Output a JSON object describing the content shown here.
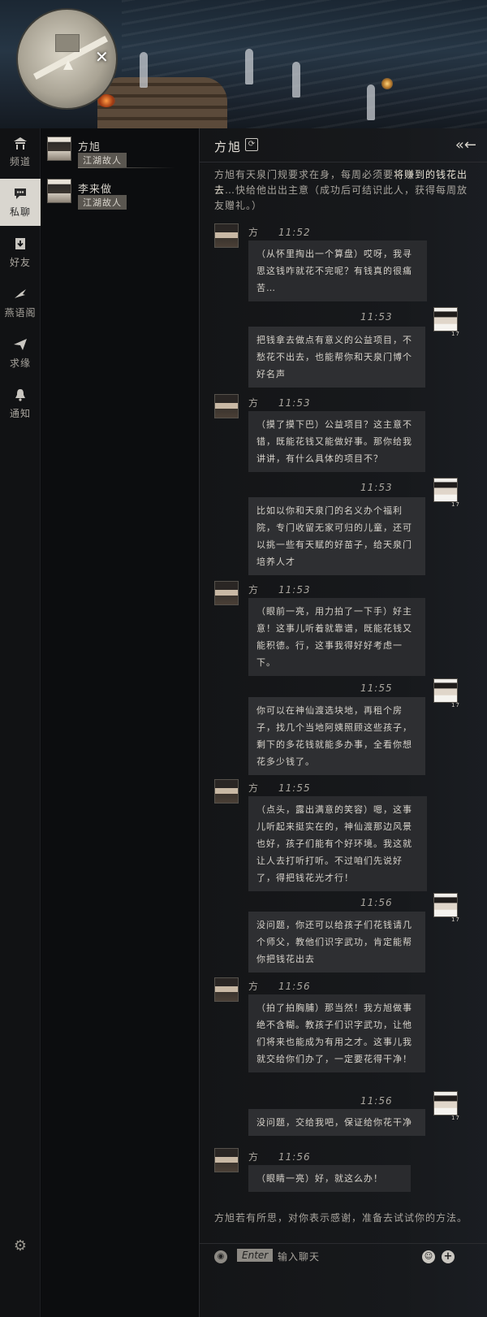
{
  "nav": [
    {
      "id": "channel",
      "label": "频道",
      "icon": "house-icon"
    },
    {
      "id": "private-chat",
      "label": "私聊",
      "icon": "chat-bubble-icon",
      "active": true
    },
    {
      "id": "friends",
      "label": "好友",
      "icon": "friend-download-icon"
    },
    {
      "id": "yanyu",
      "label": "燕语阁",
      "icon": "swallow-icon"
    },
    {
      "id": "qiuyuan",
      "label": "求缘",
      "icon": "paper-plane-icon"
    },
    {
      "id": "notice",
      "label": "通知",
      "icon": "bell-icon"
    }
  ],
  "contacts": [
    {
      "name": "方旭",
      "tag": "江湖故人",
      "selected": true
    },
    {
      "name": "李来做",
      "tag": "江湖故人",
      "selected": false
    }
  ],
  "chat": {
    "title": "方旭",
    "intro_pre": "方旭有天泉门规要求在身，每周必须要",
    "intro_highlight": "将赚到的钱花出去",
    "intro_post": "…快给他出出主意（成功后可结识此人，获得每周放友赠礼。）",
    "messages": [
      {
        "from": "other",
        "name": "方旭",
        "time": "11:52",
        "text": "（从怀里掏出一个算盘）哎呀，我寻思这钱咋就花不完呢？有钱真的很痛苦…"
      },
      {
        "from": "me",
        "time": "11:53",
        "text": "把钱拿去做点有意义的公益项目，不愁花不出去，也能帮你和天泉门博个好名声",
        "level": "17"
      },
      {
        "from": "other",
        "name": "方旭",
        "time": "11:53",
        "text": "（摸了摸下巴）公益项目？这主意不错，既能花钱又能做好事。那你给我讲讲，有什么具体的项目不？"
      },
      {
        "from": "me",
        "time": "11:53",
        "text": "比如以你和天泉门的名义办个福利院，专门收留无家可归的儿童，还可以挑一些有天赋的好苗子，给天泉门培养人才",
        "level": "17"
      },
      {
        "from": "other",
        "name": "方旭",
        "time": "11:53",
        "text": "（眼前一亮，用力拍了一下手）好主意！这事儿听着就靠谱，既能花钱又能积德。行，这事我得好好考虑一下。"
      },
      {
        "from": "me",
        "time": "11:55",
        "text": "你可以在神仙渡选块地，再租个房子，找几个当地阿姨照顾这些孩子，剩下的多花钱就能多办事，全看你想花多少钱了。",
        "level": "17"
      },
      {
        "from": "other",
        "name": "方旭",
        "time": "11:55",
        "text": "（点头，露出满意的笑容）嗯，这事儿听起来挺实在的，神仙渡那边风景也好，孩子们能有个好环境。我这就让人去打听打听。不过咱们先说好了，得把钱花光才行！"
      },
      {
        "from": "me",
        "time": "11:56",
        "text": "没问题，你还可以给孩子们花钱请几个师父，教他们识字武功，肯定能帮你把钱花出去",
        "level": "17"
      },
      {
        "from": "other",
        "name": "方旭",
        "time": "11:56",
        "text": "（拍了拍胸脯）那当然！我方旭做事绝不含糊。教孩子们识字武功，让他们将来也能成为有用之才。这事儿我就交给你们办了，一定要花得干净！"
      },
      {
        "from": "me",
        "time": "11:56",
        "text": "没问题，交给我吧，保证给你花干净",
        "level": "17"
      },
      {
        "from": "other",
        "name": "方旭",
        "time": "11:56",
        "text": "（眼睛一亮）好，就这么办！"
      }
    ],
    "outro": "方旭若有所思，对你表示感谢，准备去试试你的方法。"
  },
  "input": {
    "enter_label": "Enter",
    "placeholder": "输入聊天"
  }
}
